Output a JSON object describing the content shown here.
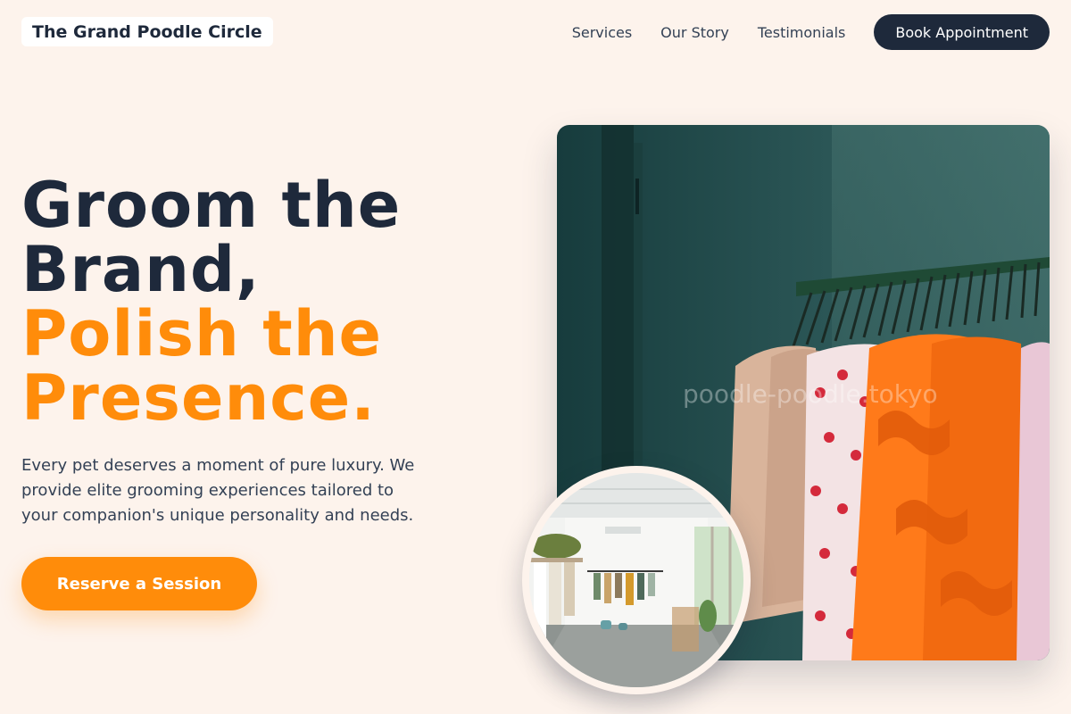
{
  "header": {
    "brand": "The Grand Poodle Circle",
    "nav": [
      "Services",
      "Our Story",
      "Testimonials"
    ],
    "cta_label": "Book Appointment"
  },
  "hero": {
    "title_dark_1": "Groom the",
    "title_dark_2": "Brand,",
    "title_accent_1": "Polish the",
    "title_accent_2": "Presence.",
    "description": "Every pet deserves a moment of pure luxury. We provide elite grooming experiences tailored to your companion's unique personality and needs.",
    "cta_label": "Reserve a Session"
  },
  "images": {
    "main_watermark": "poodle-poodle.tokyo",
    "main_alt": "clothing-rack-photo",
    "circle_alt": "boutique-interior-photo"
  },
  "colors": {
    "background": "#fdf3ec",
    "primary_dark": "#1e293b",
    "accent_orange": "#ff8c0a",
    "text_body": "#334155"
  }
}
